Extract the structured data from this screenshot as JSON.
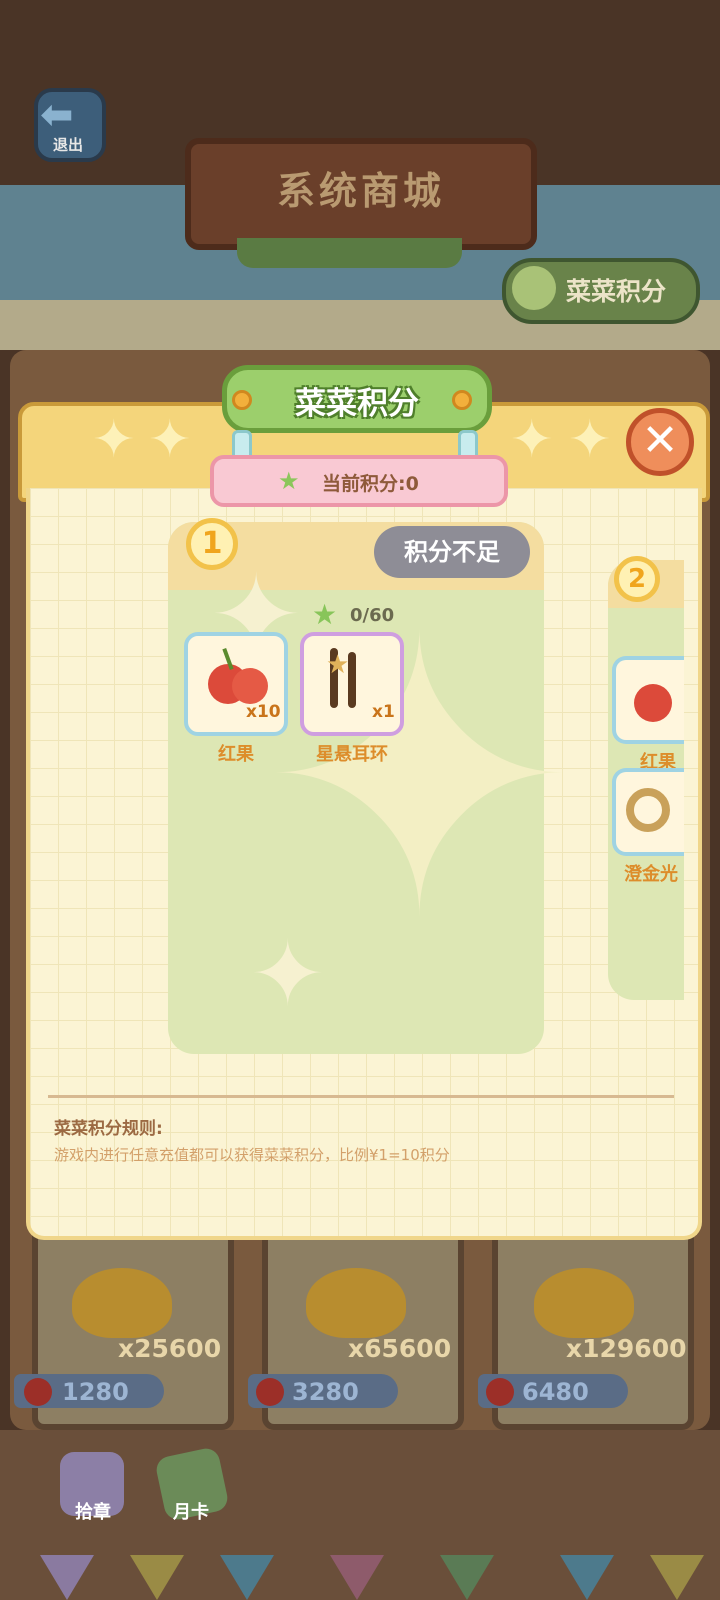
{
  "background": {
    "exit_label": "退出",
    "shop_title": "系统商城",
    "points_button_label": "菜菜积分",
    "coin_packs": [
      {
        "amount": "x25600",
        "price": "1280"
      },
      {
        "amount": "x65600",
        "price": "3280"
      },
      {
        "amount": "x129600",
        "price": "6480"
      }
    ],
    "bottom_nav": [
      {
        "label": "拾章"
      },
      {
        "label": "月卡"
      }
    ]
  },
  "modal": {
    "title": "菜菜积分",
    "current_points_label": "当前积分:0",
    "close_symbol": "✕",
    "tiers": [
      {
        "badge": "1",
        "status_button": "积分不足",
        "progress": "0/60",
        "rewards": [
          {
            "name": "红果",
            "qty": "x10",
            "icon": "cherry-icon"
          },
          {
            "name": "星悬耳环",
            "qty": "x1",
            "icon": "earring-icon"
          }
        ]
      },
      {
        "badge": "2",
        "rewards": [
          {
            "name": "红果",
            "icon": "cherry-icon"
          },
          {
            "name": "澄金光",
            "icon": "gold-ring-icon"
          }
        ]
      }
    ],
    "rules_title": "菜菜积分规则:",
    "rules_text": "游戏内进行任意充值都可以获得菜菜积分，比例¥1=10积分"
  },
  "colors": {
    "title_green": "#9ccf6c",
    "close_orange": "#ef8e5b",
    "status_gray": "#8e8d96",
    "label_orange": "#dd8d2b"
  }
}
